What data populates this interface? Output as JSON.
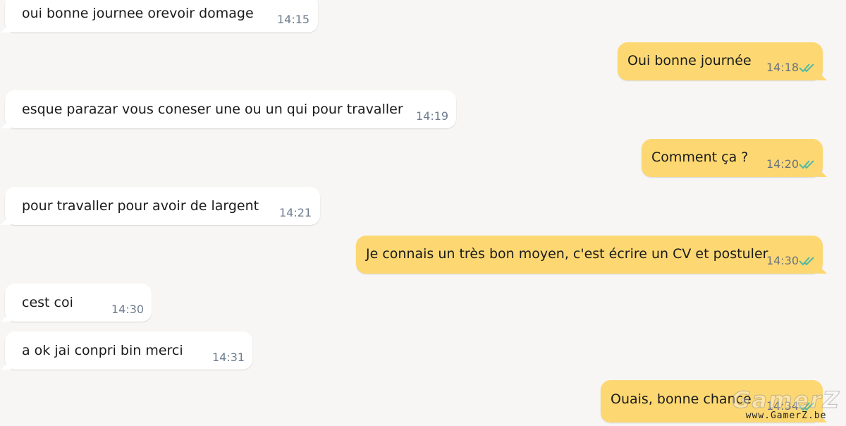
{
  "messages": [
    {
      "text": "oui bonne journee orevoir domage",
      "time": "14:15"
    },
    {
      "text": "Oui bonne journée",
      "time": "14:18"
    },
    {
      "text": "esque parazar vous coneser une ou un qui pour travaller",
      "time": "14:19"
    },
    {
      "text": "Comment ça ?",
      "time": "14:20"
    },
    {
      "text": "pour travaller pour avoir de largent",
      "time": "14:21"
    },
    {
      "text": "Je connais un très bon moyen, c'est écrire un CV et postuler",
      "time": "14:30"
    },
    {
      "text": "cest coi",
      "time": "14:30"
    },
    {
      "text": "a ok jai conpri bin merci",
      "time": "14:31"
    },
    {
      "text": "Ouais, bonne chance",
      "time": "14:34"
    }
  ],
  "watermark": {
    "brand": "GamerZ",
    "site": "www.GamerZ.be"
  },
  "colors": {
    "background": "#f7f6f4",
    "incoming": "#ffffff",
    "outgoing": "#fdd872",
    "read_ticks": "#4fb9a8"
  },
  "icons": {
    "read_receipt": "double-check-icon"
  }
}
